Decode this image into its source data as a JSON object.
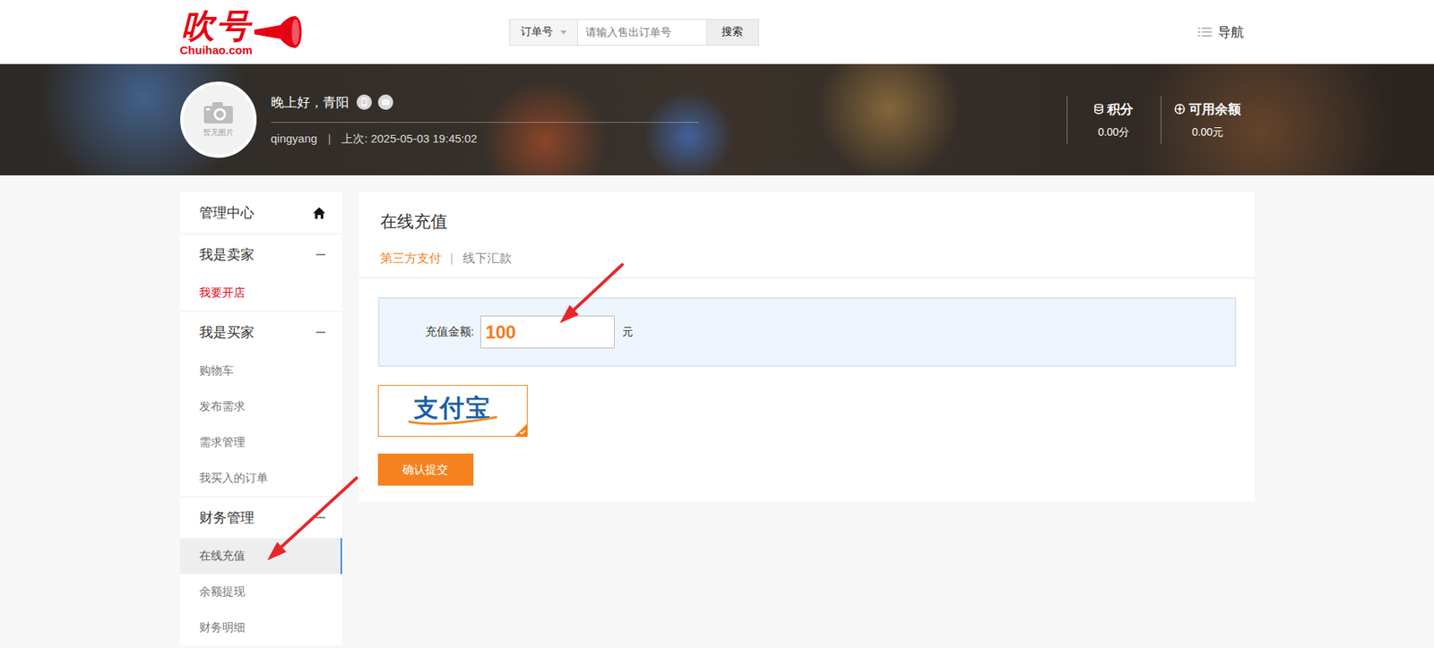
{
  "header": {
    "logo": {
      "name": "吹号",
      "domain": "Chuihao.com"
    },
    "search": {
      "type": "订单号",
      "placeholder": "请输入售出订单号",
      "button": "搜索"
    },
    "nav": "导航"
  },
  "profile": {
    "avatar_text": "暂无图片",
    "greeting": "晚上好，青阳",
    "username": "qingyang",
    "separator": "|",
    "last_login": "上次: 2025-05-03 19:45:02",
    "stats": [
      {
        "label": "积分",
        "value": "0.00分",
        "kind": "points"
      },
      {
        "label": "可用余额",
        "value": "0.00元",
        "kind": "balance"
      }
    ]
  },
  "sidebar": {
    "sections": [
      {
        "title": "管理中心",
        "kind": "home",
        "expanded": false,
        "items": []
      },
      {
        "title": "我是卖家",
        "kind": "group",
        "expanded": true,
        "items": [
          {
            "label": "我要开店",
            "selected": false,
            "highlight": true
          }
        ]
      },
      {
        "title": "我是买家",
        "kind": "group",
        "expanded": true,
        "items": [
          {
            "label": "购物车",
            "selected": false,
            "highlight": false
          },
          {
            "label": "发布需求",
            "selected": false,
            "highlight": false
          },
          {
            "label": "需求管理",
            "selected": false,
            "highlight": false
          },
          {
            "label": "我买入的订单",
            "selected": false,
            "highlight": false
          }
        ]
      },
      {
        "title": "财务管理",
        "kind": "group",
        "expanded": true,
        "items": [
          {
            "label": "在线充值",
            "selected": true,
            "highlight": false
          },
          {
            "label": "余额提现",
            "selected": false,
            "highlight": false
          },
          {
            "label": "财务明细",
            "selected": false,
            "highlight": false
          }
        ]
      }
    ]
  },
  "main": {
    "title": "在线充值",
    "tabs": [
      {
        "label": "第三方支付",
        "selected": true
      },
      {
        "label": "线下汇款",
        "selected": false
      }
    ],
    "tab_separator": "|",
    "amount": {
      "label": "充值金额:",
      "value": "100",
      "unit": "元"
    },
    "payment_methods": [
      {
        "name": "支付宝",
        "selected": true
      }
    ],
    "submit": "确认提交"
  }
}
